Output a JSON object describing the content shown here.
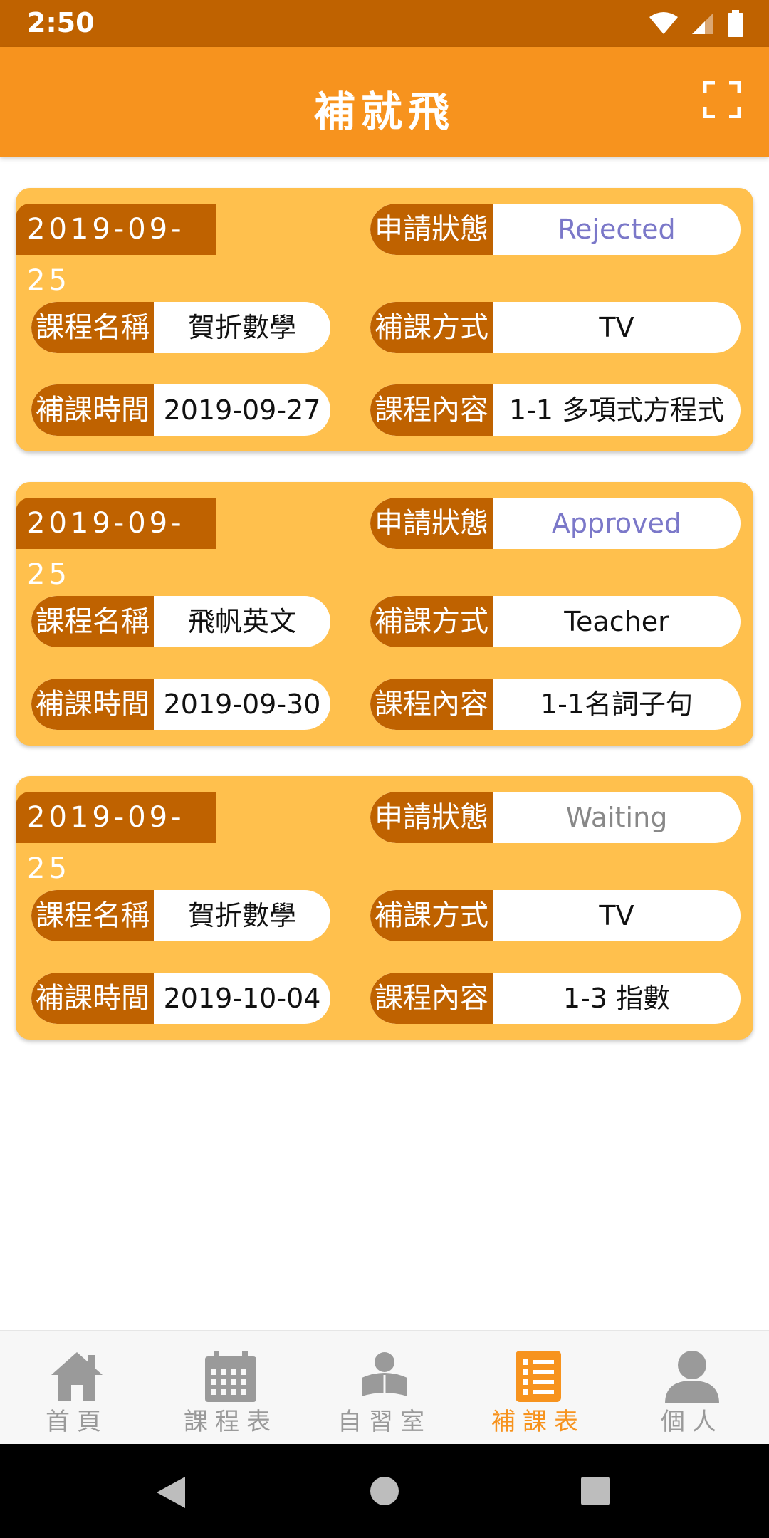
{
  "status_bar": {
    "time": "2:50"
  },
  "app_bar": {
    "title": "補就飛"
  },
  "labels": {
    "status": "申請狀態",
    "course_name": "課程名稱",
    "method": "補課方式",
    "time": "補課時間",
    "content": "課程內容"
  },
  "records": [
    {
      "date": "2019-09-25",
      "status": "Rejected",
      "course_name": "賀折數學",
      "method": "TV",
      "time": "2019-09-27",
      "content": "1-1 多項式方程式"
    },
    {
      "date": "2019-09-25",
      "status": "Approved",
      "course_name": "飛帆英文",
      "method": "Teacher",
      "time": "2019-09-30",
      "content": "1-1名詞子句"
    },
    {
      "date": "2019-09-25",
      "status": "Waiting",
      "course_name": "賀折數學",
      "method": "TV",
      "time": "2019-10-04",
      "content": "1-3 指數"
    }
  ],
  "bottom_nav": [
    {
      "label": "首頁",
      "icon": "home-icon"
    },
    {
      "label": "課程表",
      "icon": "calendar-icon"
    },
    {
      "label": "自習室",
      "icon": "study-room-icon"
    },
    {
      "label": "補課表",
      "icon": "list-icon",
      "active": true
    },
    {
      "label": "個人",
      "icon": "person-icon"
    }
  ],
  "colors": {
    "primary": "#F7931E",
    "primary_dark": "#BF6200",
    "card": "#FFC04D",
    "status_rejected": "#7B78C9",
    "status_approved": "#7B78C9",
    "status_waiting": "#888888"
  }
}
